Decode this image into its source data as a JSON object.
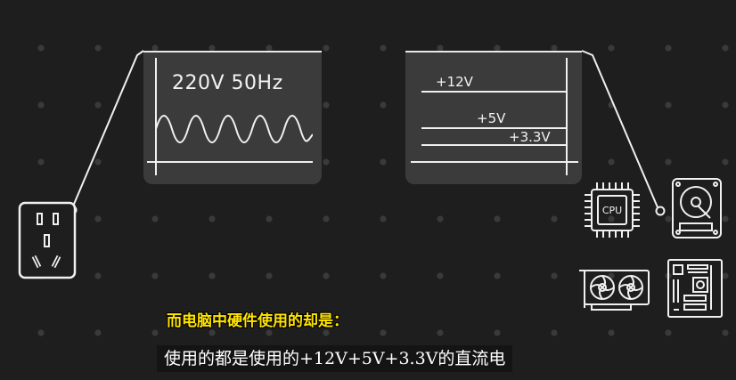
{
  "ac_panel": {
    "label": "220V 50Hz"
  },
  "dc_panel": {
    "rails": [
      "+12V",
      "+5V",
      "+3.3V"
    ]
  },
  "cpu_chip": {
    "label": "CPU"
  },
  "subtitles": {
    "line1": "而电脑中硬件使用的却是：",
    "line2": "使用的都是使用的+12V+5V+3.3V的直流电"
  },
  "colors": {
    "background": "#1e1e1e",
    "panel": "#3b3b3b",
    "highlight_text": "#ffe400",
    "line": "#f0f0f0"
  }
}
